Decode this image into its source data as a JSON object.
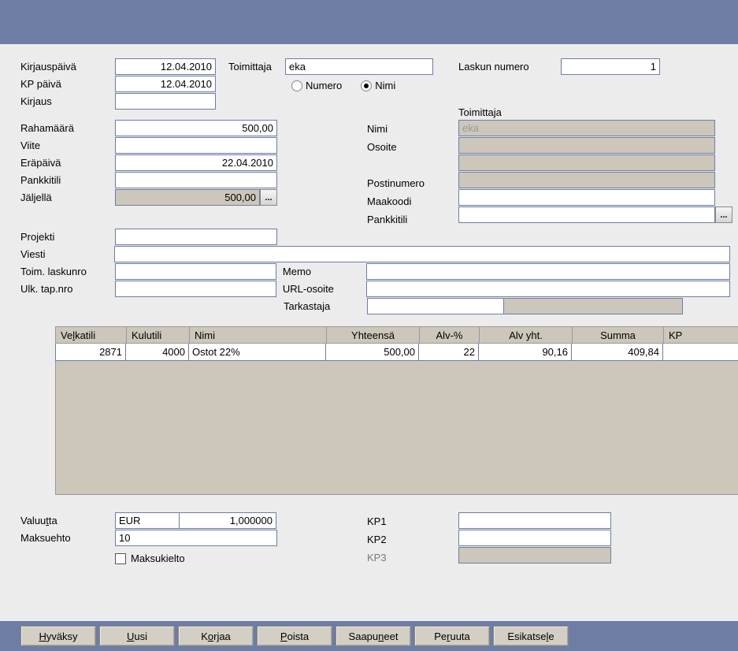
{
  "labels": {
    "kirjauspaiva": "Kirjauspäivä",
    "kp_paiva": "KP päivä",
    "kirjaus": "Kirjaus",
    "toimittaja": "Toimittaja",
    "numero": "Numero",
    "nimi_radio": "Nimi",
    "laskun_numero": "Laskun numero",
    "rahamaara": "Rahamäärä",
    "viite": "Viite",
    "erapaiva": "Eräpäivä",
    "pankkitili": "Pankkitili",
    "jaljella": "Jäljellä",
    "toimittaja_section": "Toimittaja",
    "nimi": "Nimi",
    "osoite": "Osoite",
    "postinumero": "Postinumero",
    "maakoodi": "Maakoodi",
    "pankkitili2": "Pankkitili",
    "projekti": "Projekti",
    "viesti": "Viesti",
    "toim_laskunro": "Toim. laskunro",
    "ulk_tapnro": "Ulk. tap.nro",
    "memo": "Memo",
    "url_osoite": "URL-osoite",
    "tarkastaja": "Tarkastaja",
    "valuutta": "Valuutta",
    "maksuehto": "Maksuehto",
    "maksukielto": "Maksukielto",
    "kp1": "KP1",
    "kp2": "KP2",
    "kp3": "KP3"
  },
  "values": {
    "kirjauspaiva": "12.04.2010",
    "kp_paiva": "12.04.2010",
    "kirjaus": "",
    "toimittaja": "eka",
    "laskun_numero": "1",
    "rahamaara": "500,00",
    "viite": "",
    "erapaiva": "22.04.2010",
    "pankkitili": "",
    "jaljella": "500,00",
    "toim_nimi": "eka",
    "toim_osoite1": "",
    "toim_osoite2": "",
    "toim_postinumero": "",
    "toim_maakoodi": "",
    "toim_pankkitili": "",
    "projekti": "",
    "viesti": "",
    "toim_laskunro": "",
    "ulk_tapnro": "",
    "memo": "",
    "url_osoite": "",
    "tarkastaja1": "",
    "tarkastaja2": "",
    "valuutta_code": "EUR",
    "valuutta_rate": "1,000000",
    "maksuehto": "10",
    "kp1": "",
    "kp2": "",
    "kp3": ""
  },
  "grid": {
    "headers": {
      "velkatili": "Velkatili",
      "kulutili": "Kulutili",
      "nimi": "Nimi",
      "yhteensa": "Yhteensä",
      "alv_pct": "Alv-%",
      "alv_yht": "Alv yht.",
      "summa": "Summa",
      "kp": "KP"
    },
    "rows": [
      {
        "velkatili": "2871",
        "kulutili": "4000",
        "nimi": "Ostot 22%",
        "yhteensa": "500,00",
        "alv_pct": "22",
        "alv_yht": "90,16",
        "summa": "409,84",
        "kp": ""
      }
    ]
  },
  "buttons": {
    "hyvaksy": "Hyväksy",
    "uusi": "Uusi",
    "korjaa": "Korjaa",
    "poista": "Poista",
    "saapuneet": "Saapuneet",
    "peruuta": "Peruuta",
    "esikatsele": "Esikatsele"
  },
  "chart_data": {
    "type": "table",
    "title": "",
    "columns": [
      "Velkatili",
      "Kulutili",
      "Nimi",
      "Yhteensä",
      "Alv-%",
      "Alv yht.",
      "Summa"
    ],
    "rows": [
      [
        "2871",
        "4000",
        "Ostot 22%",
        "500,00",
        "22",
        "90,16",
        "409,84"
      ]
    ]
  }
}
